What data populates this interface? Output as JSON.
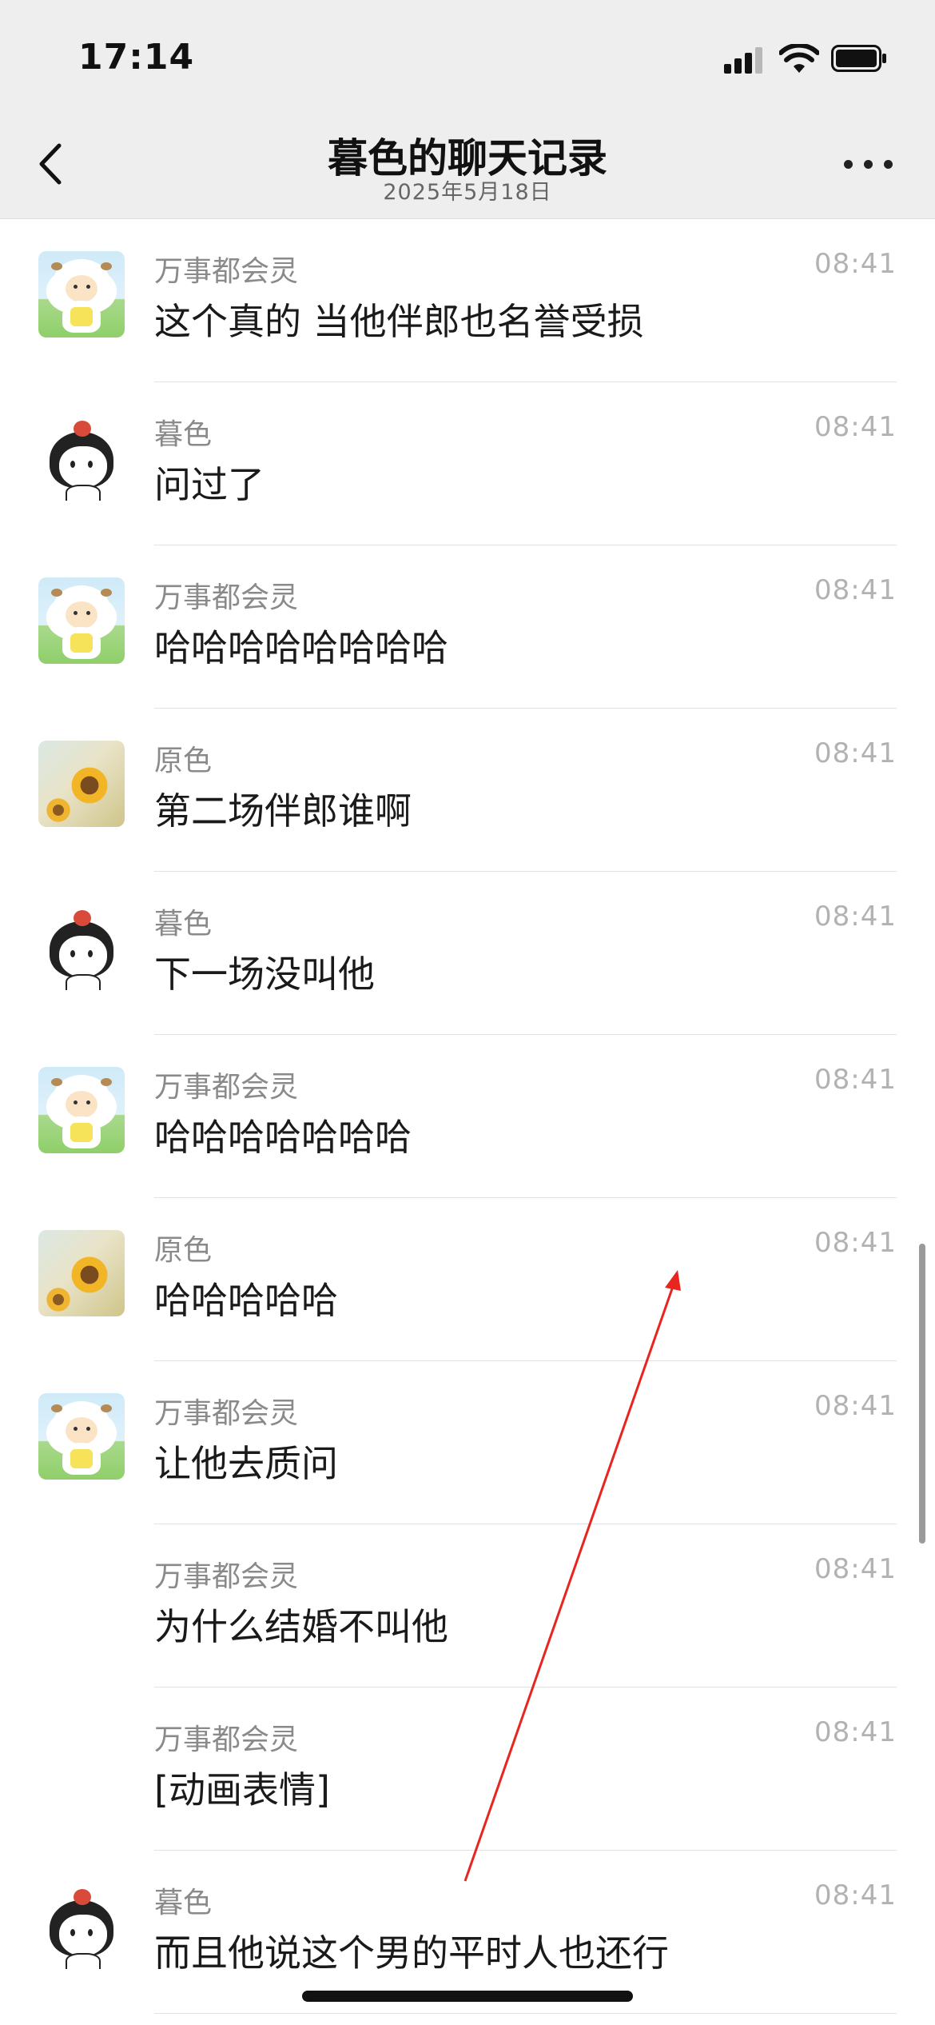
{
  "status_bar": {
    "time": "17:14"
  },
  "header": {
    "title": "暮色的聊天记录",
    "date": "2025年5月18日"
  },
  "messages": [
    {
      "sender": "万事都会灵",
      "time": "08:41",
      "text": "这个真的 当他伴郎也名誉受损",
      "avatar": "sheep"
    },
    {
      "sender": "暮色",
      "time": "08:41",
      "text": "问过了",
      "avatar": "girl"
    },
    {
      "sender": "万事都会灵",
      "time": "08:41",
      "text": "哈哈哈哈哈哈哈哈",
      "avatar": "sheep"
    },
    {
      "sender": "原色",
      "time": "08:41",
      "text": "第二场伴郎谁啊",
      "avatar": "sunflower"
    },
    {
      "sender": "暮色",
      "time": "08:41",
      "text": "下一场没叫他",
      "avatar": "girl"
    },
    {
      "sender": "万事都会灵",
      "time": "08:41",
      "text": "哈哈哈哈哈哈哈",
      "avatar": "sheep"
    },
    {
      "sender": "原色",
      "time": "08:41",
      "text": "哈哈哈哈哈",
      "avatar": "sunflower"
    },
    {
      "sender": "万事都会灵",
      "time": "08:41",
      "text": "让他去质问",
      "avatar": "sheep"
    },
    {
      "sender": "万事都会灵",
      "time": "08:41",
      "text": "为什么结婚不叫他",
      "avatar": "none"
    },
    {
      "sender": "万事都会灵",
      "time": "08:41",
      "text": "[动画表情]",
      "avatar": "none"
    },
    {
      "sender": "暮色",
      "time": "08:41",
      "text": "而且他说这个男的平时人也还行",
      "avatar": "girl"
    }
  ],
  "icons": {
    "back": "chevron-left-icon",
    "more": "more-dots-icon",
    "signal": "cellular-signal-icon",
    "wifi": "wifi-icon",
    "battery": "battery-icon"
  },
  "colors": {
    "header_bg": "#eeeeee",
    "annotation_arrow": "#e8251e"
  }
}
